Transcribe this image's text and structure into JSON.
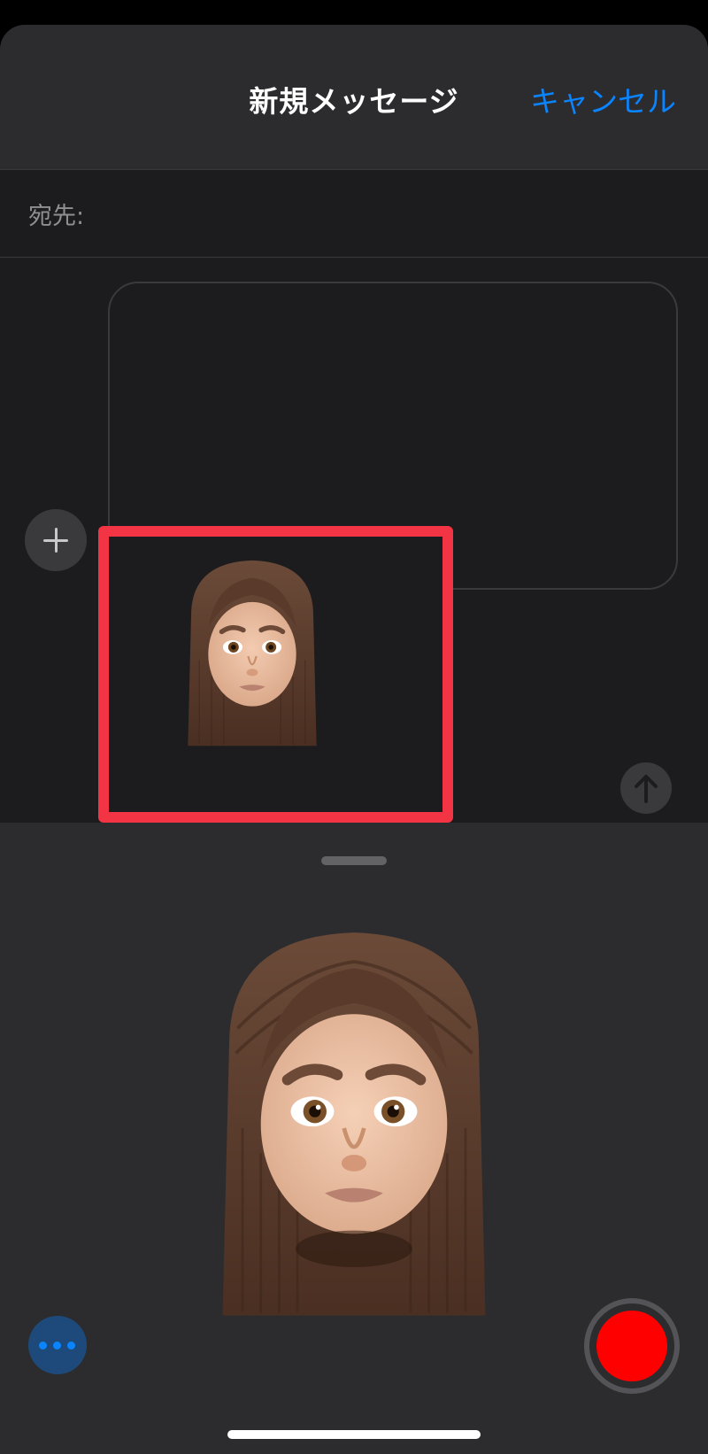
{
  "header": {
    "title": "新規メッセージ",
    "cancel_label": "キャンセル"
  },
  "recipient": {
    "to_label": "宛先:"
  },
  "colors": {
    "accent": "#0a84ff",
    "highlight_frame": "#f23445",
    "record": "#ff0000"
  },
  "icons": {
    "add": "plus-icon",
    "send": "arrow-up-icon",
    "more": "ellipsis-icon",
    "record": "record-icon"
  }
}
